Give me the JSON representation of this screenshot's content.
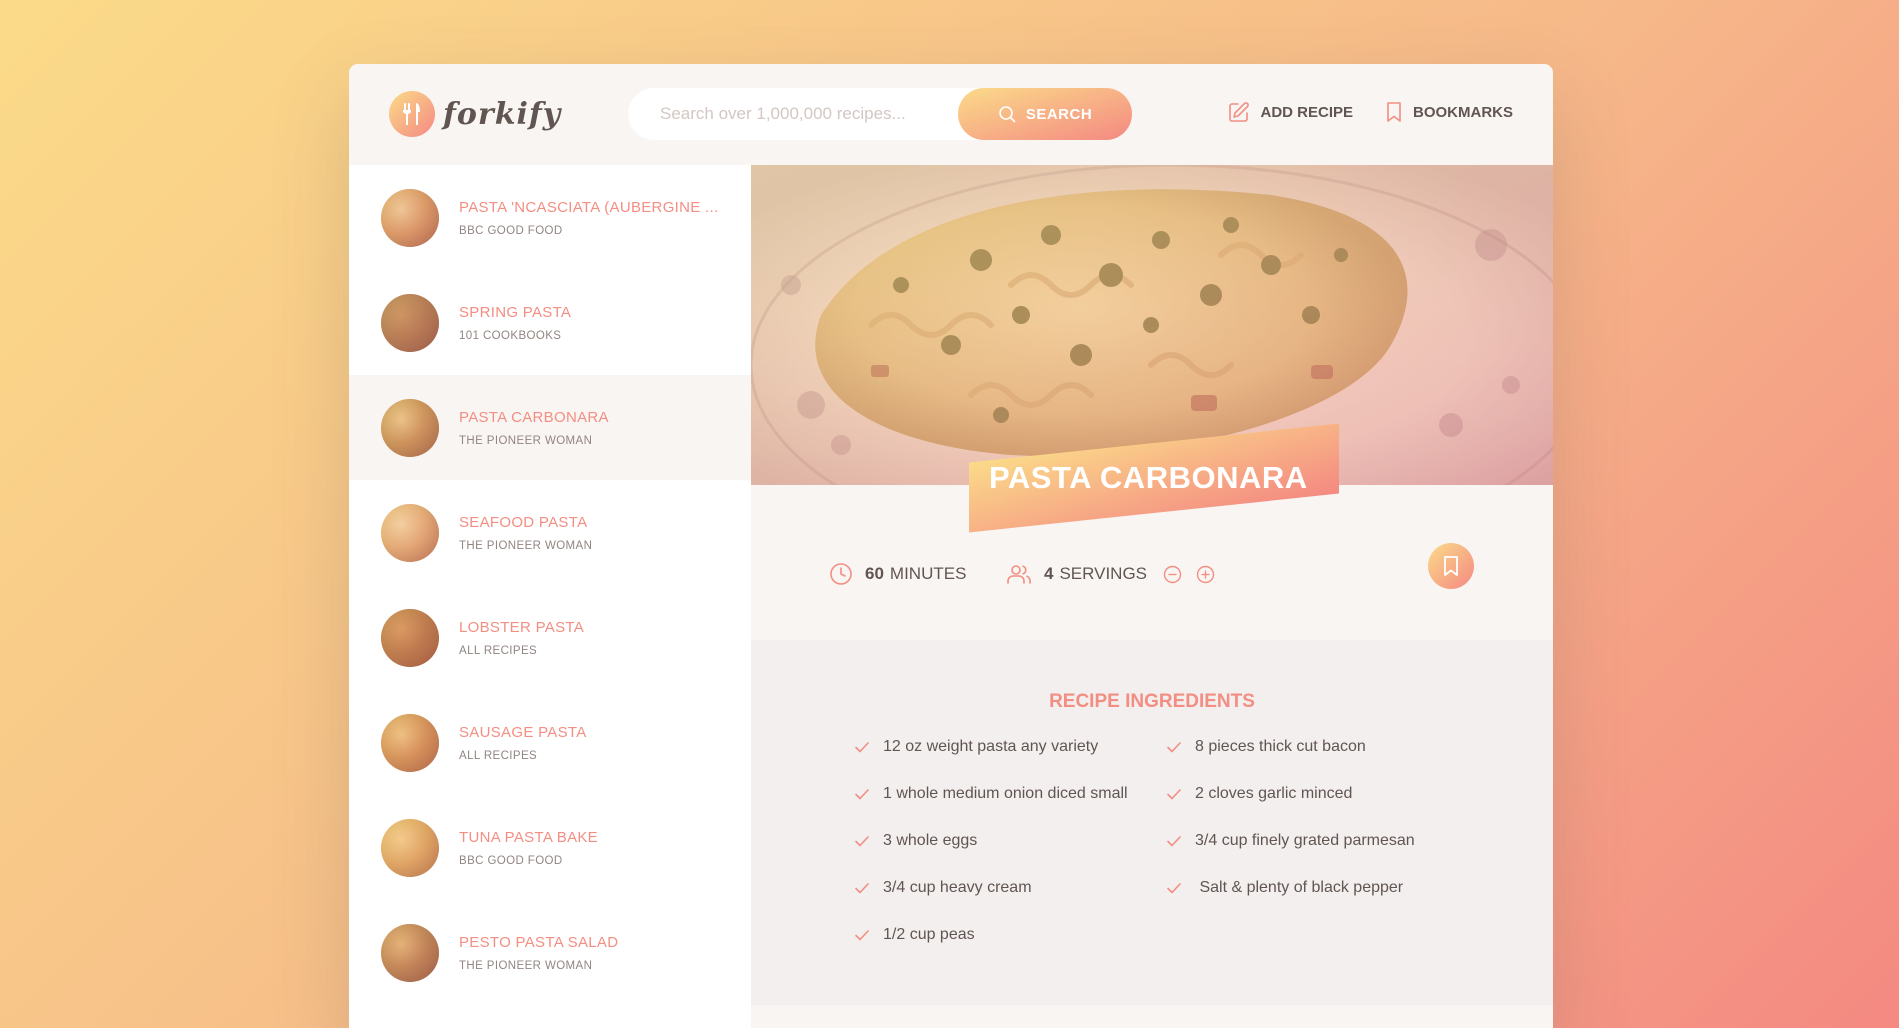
{
  "app": {
    "logo_text": "forkify"
  },
  "search": {
    "placeholder": "Search over 1,000,000 recipes...",
    "button_label": "SEARCH"
  },
  "nav": {
    "add_recipe": "ADD RECIPE",
    "bookmarks": "BOOKMARKS"
  },
  "results": [
    {
      "title": "PASTA 'NCASCIATA (AUBERGINE ...",
      "publisher": "BBC GOOD FOOD",
      "active": false
    },
    {
      "title": "SPRING PASTA",
      "publisher": "101 COOKBOOKS",
      "active": false
    },
    {
      "title": "PASTA CARBONARA",
      "publisher": "THE PIONEER WOMAN",
      "active": true
    },
    {
      "title": "SEAFOOD PASTA",
      "publisher": "THE PIONEER WOMAN",
      "active": false
    },
    {
      "title": "LOBSTER PASTA",
      "publisher": "ALL RECIPES",
      "active": false
    },
    {
      "title": "SAUSAGE PASTA",
      "publisher": "ALL RECIPES",
      "active": false
    },
    {
      "title": "TUNA PASTA BAKE",
      "publisher": "BBC GOOD FOOD",
      "active": false
    },
    {
      "title": "PESTO PASTA SALAD",
      "publisher": "THE PIONEER WOMAN",
      "active": false
    }
  ],
  "recipe": {
    "title": "PASTA CARBONARA",
    "cooking_time": "60",
    "time_unit": "MINUTES",
    "servings": "4",
    "servings_unit": "SERVINGS",
    "ingredients_heading": "RECIPE INGREDIENTS",
    "ingredients": [
      "12 oz weight pasta any variety",
      "8 pieces thick cut bacon",
      "1 whole medium onion diced small",
      "2 cloves garlic minced",
      "3 whole eggs",
      "3/4 cup finely grated parmesan",
      "3/4 cup heavy cream",
      " Salt & plenty of black pepper",
      "1/2 cup peas"
    ]
  },
  "colors": {
    "gradient_start": "#fbdb89",
    "gradient_end": "#f48982",
    "accent": "#f38e82",
    "text": "#615551",
    "bg_light": "#f9f5f3"
  },
  "icons": {
    "logo": "fork-knife-icon",
    "search": "search-icon",
    "add_recipe": "edit-icon",
    "bookmarks": "bookmark-icon",
    "time": "clock-icon",
    "servings": "users-icon",
    "decrease": "minus-circle-icon",
    "increase": "plus-circle-icon",
    "check": "check-icon"
  }
}
